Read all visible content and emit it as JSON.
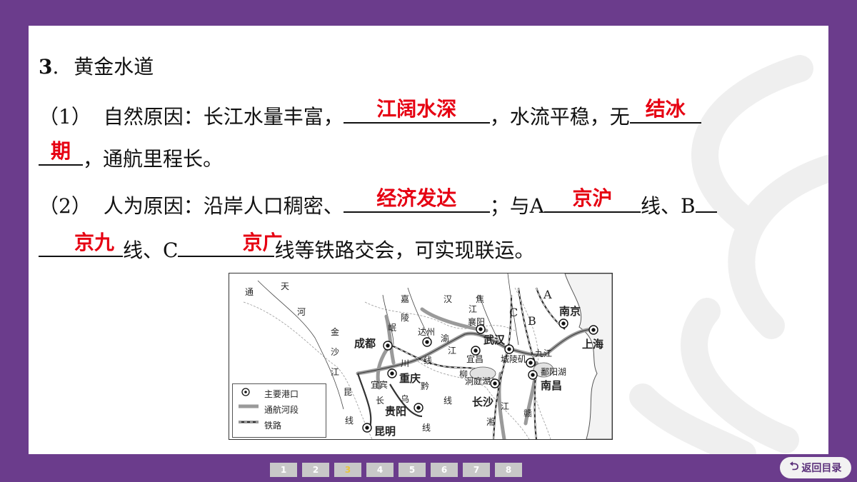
{
  "heading": {
    "number": "3",
    "sep": ".",
    "title": "黄金水道"
  },
  "q1": {
    "label": "（1）",
    "text_a": "自然原因：长江水量丰富，",
    "blank1": "江阔水深",
    "text_b": "，水流平稳，无",
    "blank2_part1": "结冰",
    "blank2_part2": "期",
    "text_c": "，通航里程长。"
  },
  "q2": {
    "label": "（2）",
    "text_a": "人为原因：沿岸人口稠密、",
    "blank1": "经济发达",
    "text_b": "；与A",
    "blank2": "京沪",
    "text_c": "线、B",
    "blank3": "京九",
    "text_d": "线、C",
    "blank4": "京广",
    "text_e": "线等铁路交会，可实现联运。"
  },
  "map": {
    "legend": {
      "port": "主要港口",
      "river": "通航河段",
      "rail": "铁路"
    },
    "cities": {
      "chengdu": "成都",
      "chongqing": "重庆",
      "guiyang": "贵阳",
      "kunming": "昆明",
      "dazhou": "达州",
      "yichang": "宜昌",
      "xiangyang": "襄阳",
      "wuhan": "武汉",
      "changsha": "长沙",
      "nanchang": "南昌",
      "jiujiang": "九江",
      "nanjing": "南京",
      "shanghai": "上海",
      "yibin": "宜宾",
      "chengshi": "城陵矶"
    },
    "lake_labels": {
      "dongting": "洞庭湖",
      "poyang": "鄱阳湖"
    },
    "letters": {
      "a": "A",
      "b": "B",
      "c": "C"
    },
    "river_chars": {
      "tong": "通",
      "tian": "天",
      "he": "河",
      "jin": "金",
      "sha": "沙",
      "jiang": "江",
      "jia": "嘉",
      "ling": "陵",
      "han": "汉",
      "jiao": "焦",
      "min": "岷",
      "chuan": "川",
      "yu": "渝",
      "xian": "线",
      "liu": "柳",
      "qian": "黔",
      "kun": "昆",
      "chang": "长",
      "wu": "乌",
      "xiang": "湘",
      "gan": "赣"
    }
  },
  "pager": {
    "pages": [
      "1",
      "2",
      "3",
      "4",
      "5",
      "6",
      "7",
      "8"
    ],
    "active": 2
  },
  "back_button": {
    "label": "返回目录"
  },
  "colors": {
    "frame": "#6b3c8c",
    "answer": "#e60012",
    "pager": "#c8c8c8"
  }
}
